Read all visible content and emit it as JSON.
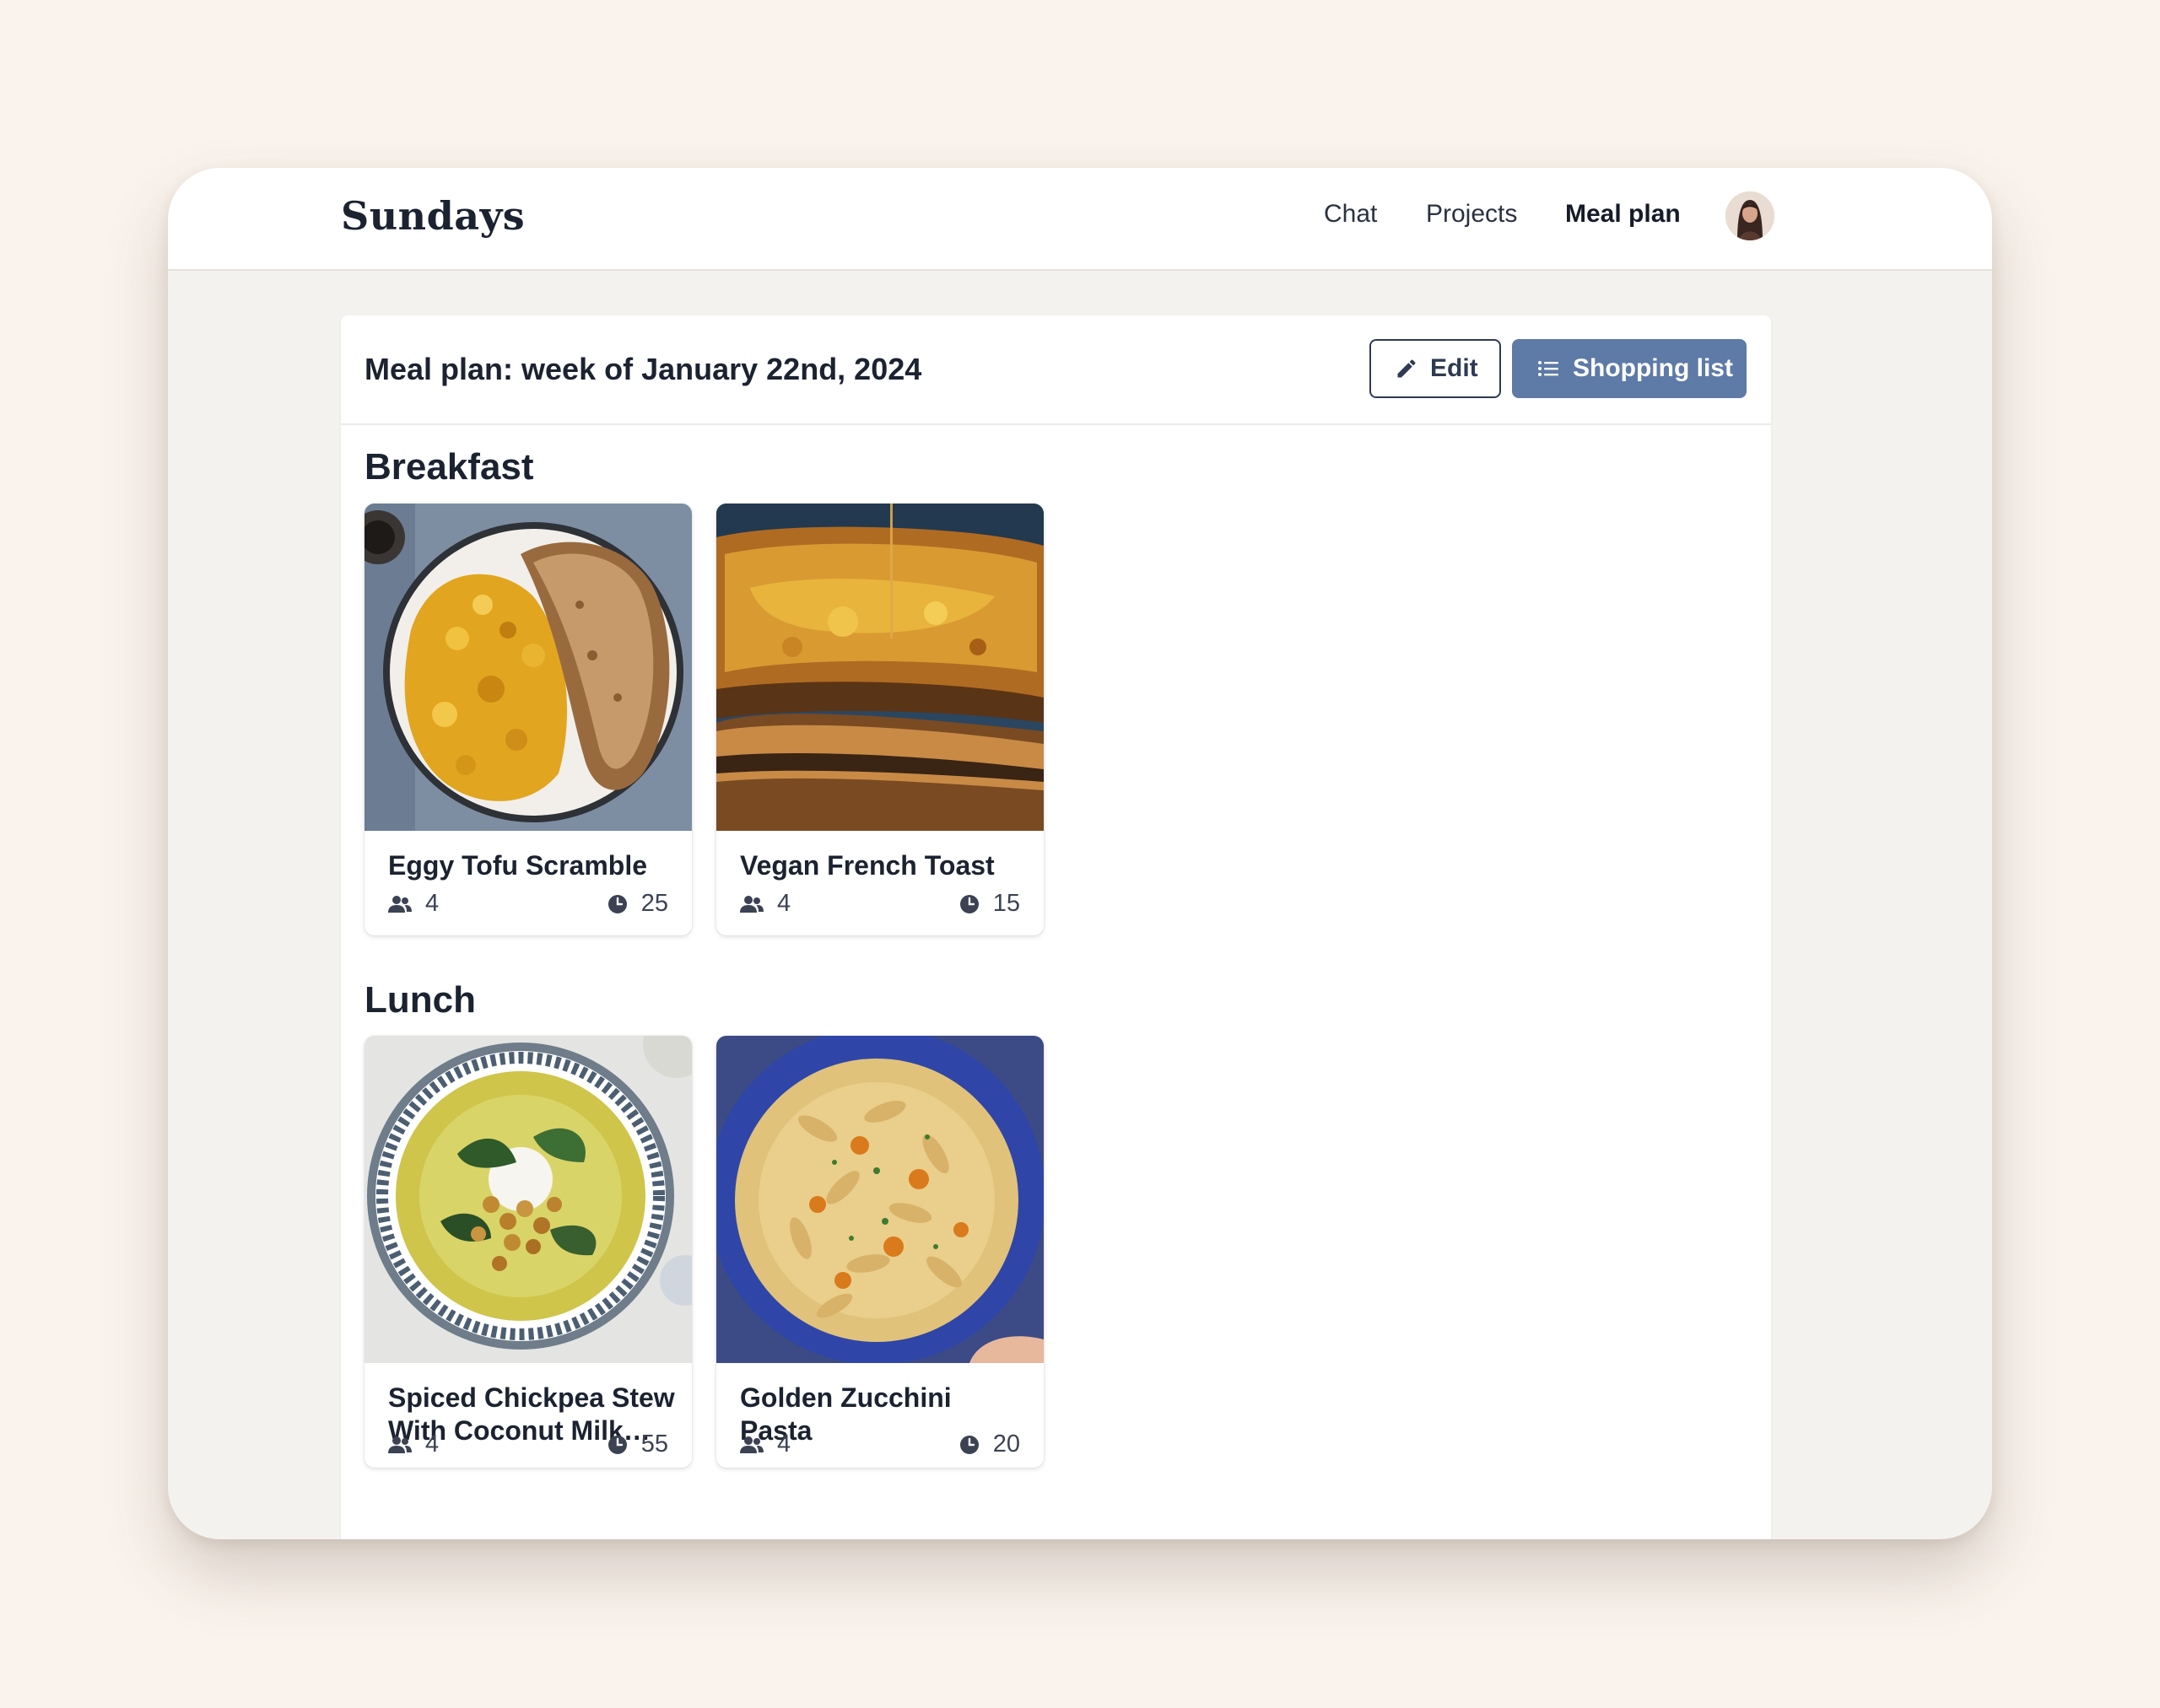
{
  "app": {
    "brand": "Sundays"
  },
  "nav": {
    "items": [
      {
        "label": "Chat",
        "active": false
      },
      {
        "label": "Projects",
        "active": false
      },
      {
        "label": "Meal plan",
        "active": true
      }
    ]
  },
  "header": {
    "title": "Meal plan: week of January 22nd, 2024",
    "edit_label": "Edit",
    "shopping_label": "Shopping list"
  },
  "colors": {
    "primary": "#5e7aa6",
    "page_bg": "#faf3ed",
    "app_bg": "#f4f2ef"
  },
  "sections": [
    {
      "title": "Breakfast",
      "meals": [
        {
          "name": "Eggy Tofu Scramble",
          "servings": "4",
          "minutes": "25"
        },
        {
          "name": "Vegan French Toast",
          "servings": "4",
          "minutes": "15"
        }
      ]
    },
    {
      "title": "Lunch",
      "meals": [
        {
          "name": "Spiced Chickpea Stew With Coconut Milk and Turmeric",
          "servings": "4",
          "minutes": "55"
        },
        {
          "name": "Golden Zucchini Pasta",
          "servings": "4",
          "minutes": "20"
        }
      ]
    }
  ]
}
